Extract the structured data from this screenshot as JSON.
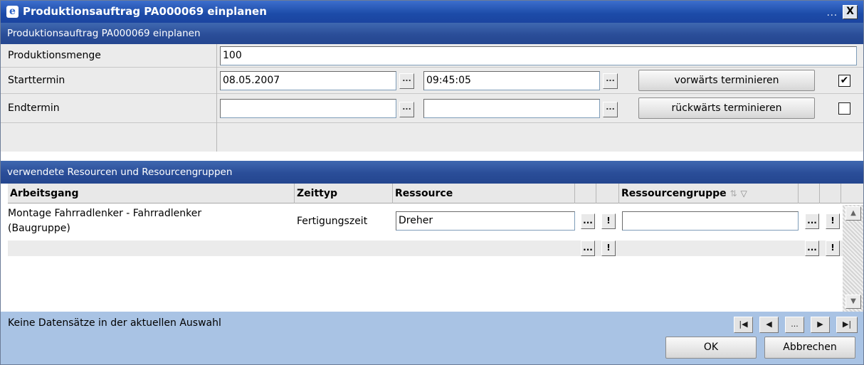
{
  "window": {
    "title": "Produktionsauftrag PA000069 einplanen",
    "dots": "...",
    "close": "X"
  },
  "section1": {
    "title": "Produktionsauftrag PA000069 einplanen"
  },
  "form": {
    "produktionsmenge": {
      "label": "Produktionsmenge",
      "value": "100"
    },
    "starttermin": {
      "label": "Starttermin",
      "date": "08.05.2007",
      "time": "09:45:05",
      "button": "vorwärts terminieren",
      "checked": true
    },
    "endtermin": {
      "label": "Endtermin",
      "date": "",
      "time": "",
      "button": "rückwärts terminieren",
      "checked": false
    },
    "ellipsis": "..."
  },
  "section2": {
    "title": "verwendete Resourcen und Resourcengruppen"
  },
  "grid": {
    "columns": [
      "Arbeitsgang",
      "Zeittyp",
      "Ressource",
      "Ressourcengruppe"
    ],
    "rows": [
      {
        "arbeitsgang_line1": "Montage Fahrradlenker - Fahrradlenker",
        "arbeitsgang_line2": "(Baugruppe)",
        "zeittyp": "Fertigungszeit",
        "ressource": "Dreher",
        "ressourcengruppe": ""
      }
    ],
    "action_ellipsis": "...",
    "action_exclamation": "!"
  },
  "status": {
    "text": "Keine Datensätze in der aktuellen Auswahl",
    "nav": [
      "|◀",
      "◀",
      "...",
      "▶",
      "▶|"
    ]
  },
  "buttons": {
    "ok": "OK",
    "cancel": "Abbrechen"
  }
}
